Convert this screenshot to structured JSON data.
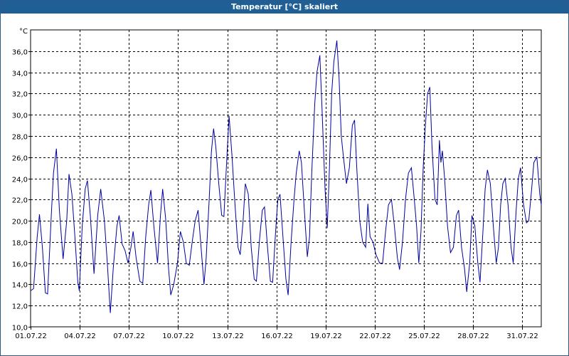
{
  "window": {
    "title": "Temperatur [°C] skaliert"
  },
  "colors": {
    "titlebar": "#1f5f96",
    "line": "#0000a0",
    "grid": "#000000",
    "background": "#ffffff"
  },
  "chart_data": {
    "type": "line",
    "title": "Temperatur [°C] skaliert",
    "ylabel": "°C",
    "xlabel": "",
    "ylim": [
      10.0,
      38.0
    ],
    "y_ticks": [
      "10,0",
      "12,0",
      "14,0",
      "16,0",
      "18,0",
      "20,0",
      "22,0",
      "24,0",
      "26,0",
      "28,0",
      "30,0",
      "32,0",
      "34,0",
      "36,0"
    ],
    "y_tick_values": [
      10,
      12,
      14,
      16,
      18,
      20,
      22,
      24,
      26,
      28,
      30,
      32,
      34,
      36
    ],
    "x_start": "01.07.22",
    "x_ticks": [
      "01.07.22",
      "04.07.22",
      "07.07.22",
      "10.07.22",
      "13.07.22",
      "16.07.22",
      "19.07.22",
      "22.07.22",
      "25.07.22",
      "28.07.22",
      "31.07.22"
    ],
    "x_tick_days": [
      1,
      4,
      7,
      10,
      13,
      16,
      19,
      22,
      25,
      28,
      31
    ],
    "xlim": [
      1,
      32.2
    ],
    "grid": true,
    "legend": "none",
    "series": [
      {
        "values": [
          [
            1.0,
            13.4
          ],
          [
            1.2,
            13.6
          ],
          [
            1.45,
            18.5
          ],
          [
            1.6,
            20.6
          ],
          [
            1.8,
            17.5
          ],
          [
            2.0,
            13.2
          ],
          [
            2.15,
            13.1
          ],
          [
            2.4,
            20.5
          ],
          [
            2.55,
            24.5
          ],
          [
            2.75,
            26.8
          ],
          [
            2.95,
            21.0
          ],
          [
            3.2,
            16.4
          ],
          [
            3.45,
            20.0
          ],
          [
            3.6,
            24.4
          ],
          [
            3.8,
            22.5
          ],
          [
            4.0,
            18.5
          ],
          [
            4.2,
            14.2
          ],
          [
            4.3,
            13.4
          ],
          [
            4.5,
            19.5
          ],
          [
            4.7,
            23.0
          ],
          [
            4.85,
            23.8
          ],
          [
            5.05,
            20.5
          ],
          [
            5.3,
            15.0
          ],
          [
            5.55,
            20.5
          ],
          [
            5.75,
            23.0
          ],
          [
            6.0,
            20.0
          ],
          [
            6.2,
            16.0
          ],
          [
            6.4,
            11.3
          ],
          [
            6.6,
            15.5
          ],
          [
            6.85,
            19.5
          ],
          [
            7.0,
            20.5
          ],
          [
            7.2,
            17.8
          ],
          [
            7.4,
            17.2
          ],
          [
            7.6,
            16.0
          ],
          [
            7.8,
            17.5
          ],
          [
            7.95,
            19.0
          ],
          [
            8.15,
            16.5
          ],
          [
            8.4,
            14.3
          ],
          [
            8.6,
            14.1
          ],
          [
            8.8,
            18.5
          ],
          [
            9.0,
            21.5
          ],
          [
            9.15,
            22.9
          ],
          [
            9.35,
            19.5
          ],
          [
            9.6,
            16.0
          ],
          [
            9.8,
            20.5
          ],
          [
            9.95,
            23.0
          ],
          [
            10.15,
            20.2
          ],
          [
            10.35,
            15.5
          ],
          [
            10.5,
            13.0
          ],
          [
            10.7,
            14.0
          ],
          [
            10.95,
            16.0
          ],
          [
            11.15,
            19.0
          ],
          [
            11.35,
            18.0
          ],
          [
            11.55,
            16.0
          ],
          [
            11.75,
            15.8
          ],
          [
            11.95,
            18.0
          ],
          [
            12.15,
            20.0
          ],
          [
            12.35,
            21.0
          ],
          [
            12.55,
            17.5
          ],
          [
            12.75,
            14.0
          ],
          [
            12.9,
            16.5
          ],
          [
            13.1,
            22.0
          ],
          [
            13.25,
            26.5
          ],
          [
            13.4,
            28.7
          ],
          [
            13.55,
            27.0
          ],
          [
            13.75,
            23.5
          ],
          [
            13.95,
            20.5
          ],
          [
            14.1,
            20.4
          ],
          [
            14.3,
            26.0
          ],
          [
            14.45,
            29.9
          ],
          [
            14.65,
            26.0
          ],
          [
            14.85,
            21.5
          ],
          [
            15.05,
            17.5
          ],
          [
            15.2,
            16.8
          ],
          [
            15.4,
            20.0
          ],
          [
            15.55,
            23.5
          ],
          [
            15.75,
            22.5
          ],
          [
            15.95,
            17.5
          ],
          [
            16.15,
            14.5
          ],
          [
            16.3,
            14.3
          ],
          [
            16.5,
            18.0
          ],
          [
            16.7,
            21.0
          ],
          [
            16.85,
            21.3
          ],
          [
            17.05,
            17.5
          ],
          [
            17.25,
            14.3
          ],
          [
            17.4,
            14.2
          ],
          [
            17.6,
            19.0
          ],
          [
            17.75,
            22.0
          ],
          [
            17.9,
            22.5
          ],
          [
            18.1,
            18.5
          ],
          [
            18.3,
            14.5
          ],
          [
            18.45,
            13.0
          ],
          [
            18.65,
            18.0
          ],
          [
            18.85,
            22.0
          ],
          [
            19.0,
            24.5
          ],
          [
            19.2,
            26.6
          ],
          [
            19.35,
            25.5
          ],
          [
            19.55,
            21.0
          ],
          [
            19.75,
            16.6
          ],
          [
            19.9,
            18.5
          ],
          [
            20.05,
            24.5
          ],
          [
            20.25,
            31.0
          ],
          [
            20.4,
            34.0
          ],
          [
            20.6,
            35.6
          ],
          [
            20.75,
            30.5
          ],
          [
            20.95,
            23.0
          ],
          [
            21.1,
            19.3
          ],
          [
            21.25,
            25.0
          ],
          [
            21.4,
            32.0
          ],
          [
            21.55,
            35.0
          ],
          [
            21.75,
            37.0
          ],
          [
            21.9,
            33.5
          ],
          [
            22.05,
            28.0
          ],
          [
            22.2,
            26.0
          ],
          [
            22.4,
            23.5
          ],
          [
            22.6,
            25.0
          ],
          [
            22.8,
            29.0
          ],
          [
            22.95,
            29.5
          ],
          [
            23.1,
            25.0
          ],
          [
            23.3,
            20.0
          ],
          [
            23.5,
            18.0
          ],
          [
            23.7,
            17.5
          ],
          [
            23.85,
            21.6
          ],
          [
            24.0,
            18.5
          ],
          [
            24.2,
            18.0
          ],
          [
            24.4,
            16.8
          ],
          [
            24.65,
            16.0
          ],
          [
            24.85,
            16.0
          ],
          [
            25.05,
            19.0
          ],
          [
            25.25,
            21.5
          ],
          [
            25.45,
            22.0
          ],
          [
            25.65,
            19.5
          ],
          [
            25.85,
            16.5
          ],
          [
            26.0,
            15.4
          ],
          [
            26.2,
            18.0
          ],
          [
            26.4,
            22.0
          ],
          [
            26.6,
            24.5
          ],
          [
            26.8,
            25.0
          ],
          [
            27.0,
            22.0
          ],
          [
            27.15,
            19.5
          ],
          [
            27.3,
            16.0
          ],
          [
            27.45,
            19.0
          ],
          [
            27.6,
            25.0
          ],
          [
            27.75,
            29.0
          ],
          [
            27.9,
            32.0
          ],
          [
            28.05,
            32.6
          ],
          [
            28.2,
            27.0
          ],
          [
            28.4,
            22.0
          ],
          [
            28.55,
            21.5
          ],
          [
            28.7,
            27.6
          ],
          [
            28.8,
            25.5
          ],
          [
            28.9,
            26.6
          ],
          [
            29.05,
            24.0
          ],
          [
            29.25,
            19.5
          ],
          [
            29.45,
            17.0
          ],
          [
            29.65,
            17.5
          ],
          [
            29.85,
            20.5
          ],
          [
            30.0,
            21.0
          ],
          [
            30.2,
            17.5
          ],
          [
            30.4,
            15.5
          ],
          [
            30.55,
            13.3
          ],
          [
            30.75,
            16.0
          ],
          [
            30.9,
            20.5
          ],
          [
            31.1,
            19.5
          ],
          [
            31.3,
            16.0
          ],
          [
            31.45,
            14.2
          ],
          [
            31.65,
            19.0
          ],
          [
            31.8,
            23.0
          ],
          [
            31.95,
            24.8
          ],
          [
            32.15,
            23.5
          ],
          [
            32.35,
            19.5
          ],
          [
            32.55,
            16.0
          ],
          [
            32.7,
            17.5
          ],
          [
            32.85,
            21.5
          ],
          [
            33.0,
            23.5
          ],
          [
            33.15,
            24.0
          ],
          [
            33.35,
            21.5
          ],
          [
            33.55,
            17.5
          ],
          [
            33.7,
            16.0
          ],
          [
            33.9,
            21.0
          ],
          [
            34.05,
            24.0
          ],
          [
            34.2,
            25.0
          ],
          [
            34.4,
            21.5
          ],
          [
            34.6,
            19.8
          ],
          [
            34.75,
            20.0
          ],
          [
            34.95,
            23.0
          ],
          [
            35.1,
            25.5
          ],
          [
            35.3,
            26.0
          ],
          [
            35.5,
            22.5
          ],
          [
            35.6,
            21.5
          ]
        ]
      }
    ]
  }
}
